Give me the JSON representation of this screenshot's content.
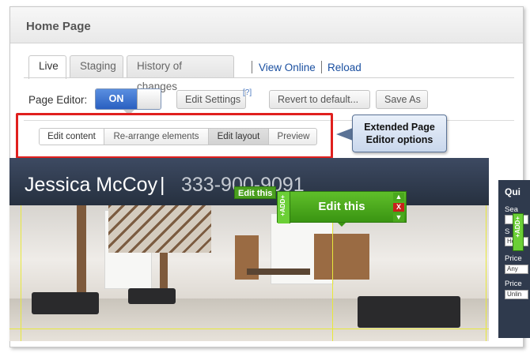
{
  "window": {
    "title": "Home Page"
  },
  "tabs": [
    {
      "label": "Live",
      "active": true
    },
    {
      "label": "Staging",
      "active": false
    },
    {
      "label": "History of changes",
      "active": false
    }
  ],
  "links": {
    "view_online": "View Online",
    "reload": "Reload"
  },
  "page_editor": {
    "label": "Page Editor:",
    "toggle_state": "ON",
    "buttons": {
      "edit_settings": "Edit Settings",
      "help": "[?]",
      "revert": "Revert to default...",
      "save_as": "Save As"
    }
  },
  "editor_options": {
    "items": [
      {
        "label": "Edit content",
        "state": "selected"
      },
      {
        "label": "Re-arrange elements",
        "state": "normal"
      },
      {
        "label": "Edit layout",
        "state": "active"
      },
      {
        "label": "Preview",
        "state": "normal"
      }
    ]
  },
  "annotation": {
    "line1": "Extended Page",
    "line2": "Editor options",
    "highlight_color": "#e0201e"
  },
  "site": {
    "name": "Jessica McCoy",
    "divider": "|",
    "phone": "333-900-9091",
    "edit_small": "Edit this",
    "edit_big": "Edit this",
    "add_label": "+ADD+",
    "close_label": "X",
    "up_label": "▲",
    "down_label": "▼"
  },
  "quick_search": {
    "title": "Qui",
    "rows": [
      {
        "label": "Sea",
        "value": ""
      },
      {
        "label": "S",
        "value": "Hou"
      },
      {
        "label": "Price",
        "value": "Any"
      },
      {
        "label": "Price",
        "value": "Unlin"
      }
    ],
    "add_label": "+ADD+"
  },
  "colors": {
    "accent_blue": "#2a5fc0",
    "edit_green": "#3a9412",
    "site_bg": "#2f3a4d"
  }
}
